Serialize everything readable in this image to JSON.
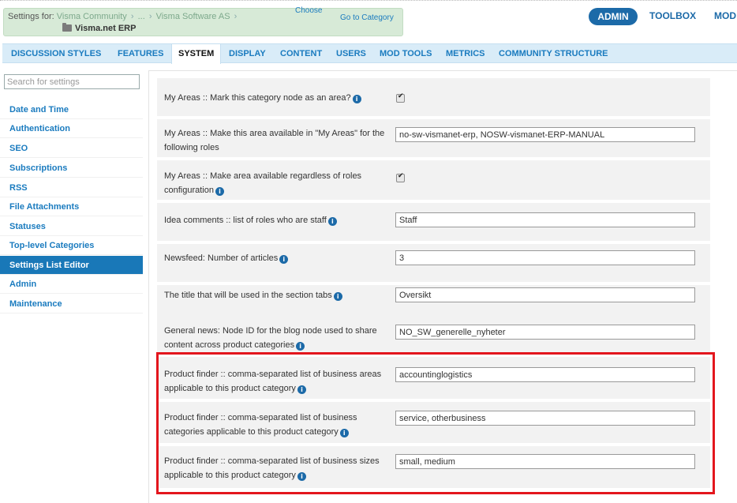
{
  "breadcrumb": {
    "prefix": "Settings for:",
    "community": "Visma Community",
    "ellipsis": "...",
    "company": "Visma Software AS",
    "current": "Visma.net ERP",
    "choose": "Choose",
    "goto": "Go to Category"
  },
  "topnav": {
    "admin": "ADMIN",
    "toolbox": "TOOLBOX",
    "mod": "MOD"
  },
  "tabs": [
    "DISCUSSION STYLES",
    "FEATURES",
    "SYSTEM",
    "DISPLAY",
    "CONTENT",
    "USERS",
    "MOD TOOLS",
    "METRICS",
    "COMMUNITY STRUCTURE"
  ],
  "sidebar": {
    "search_placeholder": "Search for settings",
    "items": [
      "Date and Time",
      "Authentication",
      "SEO",
      "Subscriptions",
      "RSS",
      "File Attachments",
      "Statuses",
      "Top-level Categories",
      "Settings List Editor",
      "Admin",
      "Maintenance"
    ],
    "active_item": "Settings List Editor"
  },
  "settings": [
    {
      "label": "My Areas :: Mark this category node as an area?",
      "type": "checkbox",
      "checked": true
    },
    {
      "label": "My Areas :: Make this area available in \"My Areas\" for the following roles",
      "type": "text",
      "value": "no-sw-vismanet-erp, NOSW-vismanet-ERP-MANUAL"
    },
    {
      "label": "My Areas :: Make area available regardless of roles configuration",
      "type": "checkbox",
      "checked": true
    },
    {
      "label": "Idea comments :: list of roles who are staff",
      "type": "text",
      "value": "Staff"
    },
    {
      "label": "Newsfeed: Number of articles",
      "type": "text",
      "value": "3"
    },
    {
      "label": "The title that will be used in the section tabs",
      "type": "text",
      "value": "Oversikt"
    },
    {
      "label": "General news: Node ID for the blog node used to share content across product categories",
      "type": "text",
      "value": "NO_SW_generelle_nyheter"
    },
    {
      "label": "Product finder :: comma-separated list of business areas applicable to this product category",
      "type": "text",
      "value": "accountinglogistics"
    },
    {
      "label": "Product finder :: comma-separated list of business categories applicable to this product category",
      "type": "text",
      "value": "service, otherbusiness"
    },
    {
      "label": "Product finder :: comma-separated list of business sizes applicable to this product category",
      "type": "text",
      "value": "small, medium"
    }
  ],
  "colors": {
    "accent": "#1a7bbf",
    "active_bg": "#1978b8",
    "highlight": "#e3161d",
    "crumb_bg": "#d7ead7"
  }
}
